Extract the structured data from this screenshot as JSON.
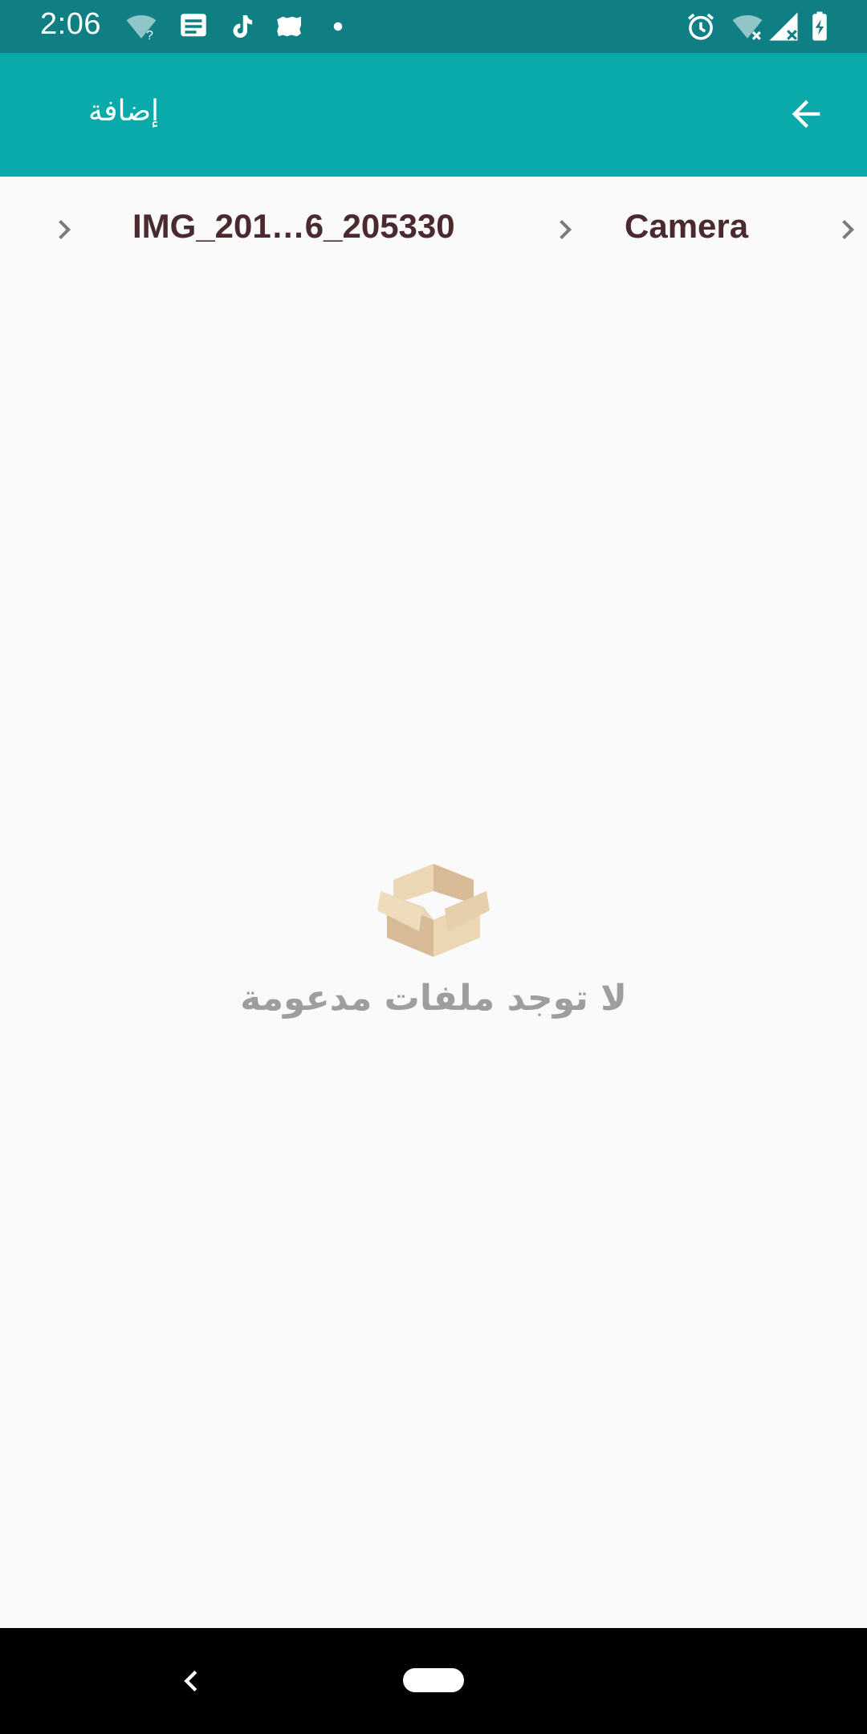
{
  "status_bar": {
    "time": "2:06",
    "icons": [
      "wifi-question-icon",
      "message-icon",
      "tiktok-icon",
      "sudan-map-icon",
      "dot-icon",
      "alarm-icon",
      "wifi-off-icon",
      "signal-off-icon",
      "battery-charging-icon"
    ]
  },
  "app_bar": {
    "title": "إضافة",
    "back_icon": "arrow-back-icon",
    "background": "#09aaa9"
  },
  "breadcrumb": {
    "items": [
      {
        "label": "Camera"
      },
      {
        "label": "IMG_201…6_205330"
      }
    ]
  },
  "empty_state": {
    "icon": "open-box-icon",
    "message": "لا توجد ملفات مدعومة"
  },
  "nav_bar": {
    "back_icon": "nav-back-icon",
    "home_icon": "nav-home-pill"
  }
}
